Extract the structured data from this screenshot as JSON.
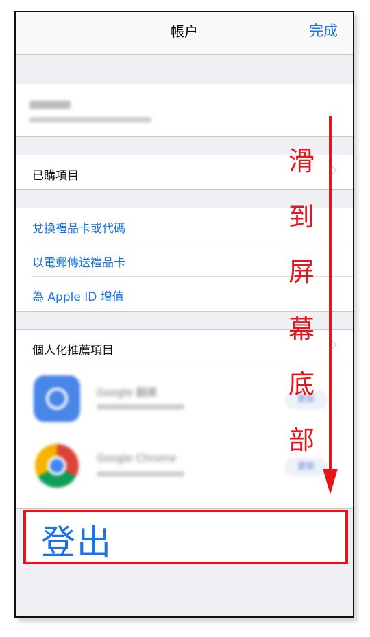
{
  "navbar": {
    "title": "帳户",
    "done_label": "完成"
  },
  "rows": {
    "purchased": "已購項目",
    "redeem": "兌換禮品卡或代碼",
    "send_gift": "以電郵傳送禮品卡",
    "add_funds": "為 Apple ID 增值",
    "personalized": "個人化推薦項目"
  },
  "apps": [
    {
      "name": "Google 翻譯",
      "icon": "google-translate-icon",
      "button": "更新"
    },
    {
      "name": "Google Chrome",
      "icon": "google-chrome-icon",
      "button": "更新"
    }
  ],
  "logout_label": "登出",
  "annotation": {
    "chars": [
      "滑",
      "到",
      "屏",
      "幕",
      "底",
      "部"
    ]
  },
  "colors": {
    "accent": "#1a73e8",
    "annotation_red": "#e8141a",
    "background": "#efeff4"
  }
}
